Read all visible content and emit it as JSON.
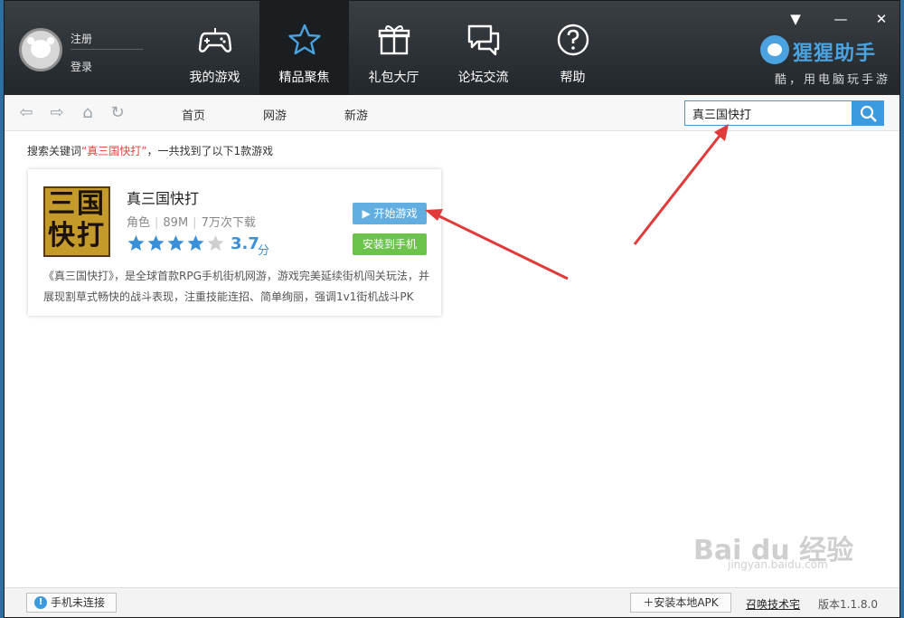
{
  "header": {
    "user": {
      "register_label": "注册",
      "login_label": "登录"
    },
    "nav": [
      {
        "label": "我的游戏",
        "icon": "gamepad-icon"
      },
      {
        "label": "精品聚焦",
        "icon": "star-icon",
        "active": true
      },
      {
        "label": "礼包大厅",
        "icon": "gift-icon"
      },
      {
        "label": "论坛交流",
        "icon": "chat-icon"
      },
      {
        "label": "帮助",
        "icon": "help-icon"
      }
    ],
    "window_controls": {
      "menu": "▼",
      "minimize": "—",
      "close": "✕"
    },
    "brand": {
      "name": "猩猩助手",
      "slogan": "酷，用电脑玩手游"
    }
  },
  "toolbar": {
    "links": [
      "首页",
      "网游",
      "新游"
    ],
    "search": {
      "value": "真三国快打"
    }
  },
  "results": {
    "summary_prefix": "搜索关键词",
    "keyword_quoted": "“真三国快打”",
    "summary_suffix": "，一共找到了以下1款游戏"
  },
  "game": {
    "icon_text": "三国快打",
    "title": "真三国快打",
    "category": "角色",
    "size": "89M",
    "downloads": "7万次下载",
    "stars_filled": 4,
    "stars_total": 5,
    "rating": "3.7",
    "rating_unit": "分",
    "play_label": "▶ 开始游戏",
    "install_label": "安装到手机",
    "description": "《真三国快打》，是全球首款RPG手机街机网游，游戏完美延续街机闯关玩法，并展现割草式畅快的战斗表现，注重技能连招、简单绚丽，强调1v1街机战斗PK"
  },
  "statusbar": {
    "phone_status": "手机未连接",
    "install_apk": "＋安装本地APK",
    "summon_link": "召唤技术宅",
    "version": "版本1.1.8.0"
  },
  "watermark": {
    "text": "Bai du 经验",
    "url": "jingyan.baidu.com"
  },
  "colors": {
    "accent": "#3c9be0",
    "header_bg": "#2b3034",
    "play": "#62aee0",
    "install": "#6cc34b",
    "star_on": "#3a8fd6",
    "star_off": "#cfcfcf",
    "arrow": "#e03a3a",
    "keyword": "#e0423a"
  }
}
